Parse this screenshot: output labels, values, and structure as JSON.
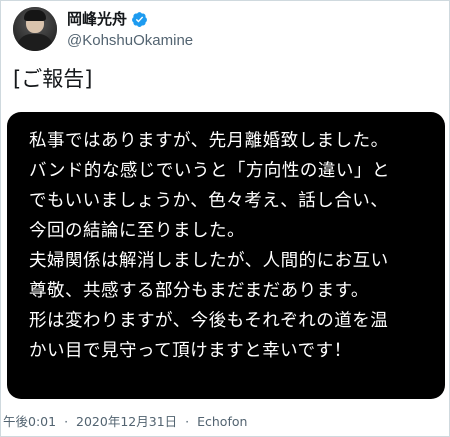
{
  "account": {
    "display_name": "岡峰光舟",
    "handle": "@KohshuOkamine",
    "verified": true,
    "verified_color": "#1d9bf0"
  },
  "tweet": {
    "text": "[ご報告]",
    "image_lines": [
      "私事ではありますが、先月離婚致しました。",
      "バンド的な感じでいうと「方向性の違い」と",
      "でもいいましょうか、色々考え、話し合い、",
      "今回の結論に至りました。",
      "夫婦関係は解消しましたが、人間的にお互い",
      "尊敬、共感する部分もまだまだあります。",
      "形は変わりますが、今後もそれぞれの道を温",
      "かい目で見守って頂けますと幸いです！"
    ],
    "image_bg_color": "#000000",
    "image_text_color": "#ffffff"
  },
  "meta": {
    "time": "午後0:01",
    "separator": "·",
    "date": "2020年12月31日",
    "client": "Echofon"
  }
}
